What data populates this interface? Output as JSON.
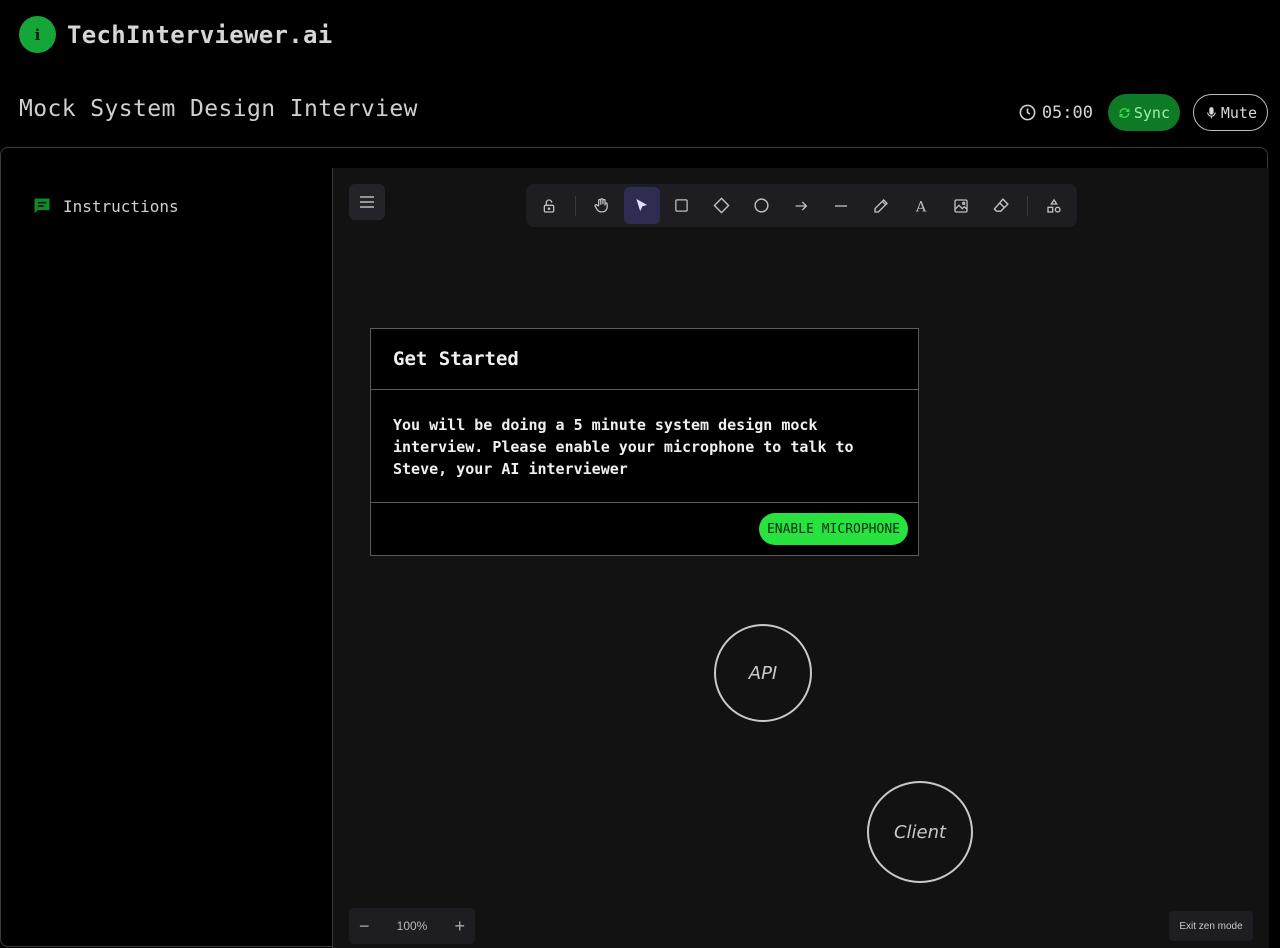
{
  "brand": {
    "badge_letter": "i",
    "name": "TechInterviewer.ai",
    "color": "#15a63a"
  },
  "header": {
    "title": "Mock System Design Interview",
    "timer": "05:00",
    "sync_label": "Sync",
    "mute_label": "Mute"
  },
  "sidebar": {
    "items": [
      {
        "label": "Instructions",
        "icon": "chat-icon"
      }
    ]
  },
  "toolbar": {
    "tools": [
      "lock-icon",
      "hand-icon",
      "select-icon",
      "rectangle-icon",
      "diamond-icon",
      "ellipse-icon",
      "arrow-icon",
      "line-icon",
      "pencil-icon",
      "text-icon",
      "image-icon",
      "eraser-icon",
      "library-icon"
    ],
    "active": "select-icon",
    "text_glyph": "A"
  },
  "canvas": {
    "shapes": [
      {
        "type": "ellipse",
        "label": "API"
      },
      {
        "type": "ellipse",
        "label": "Client"
      }
    ],
    "zoom": {
      "minus": "−",
      "value": "100%",
      "plus": "+"
    },
    "exit_zen_label": "Exit zen mode"
  },
  "modal": {
    "title": "Get Started",
    "body": "You will be doing a 5 minute system design mock interview. Please enable your microphone to talk to Steve, your AI interviewer",
    "button_label": "ENABLE MICROPHONE",
    "accent": "#27e23f"
  }
}
